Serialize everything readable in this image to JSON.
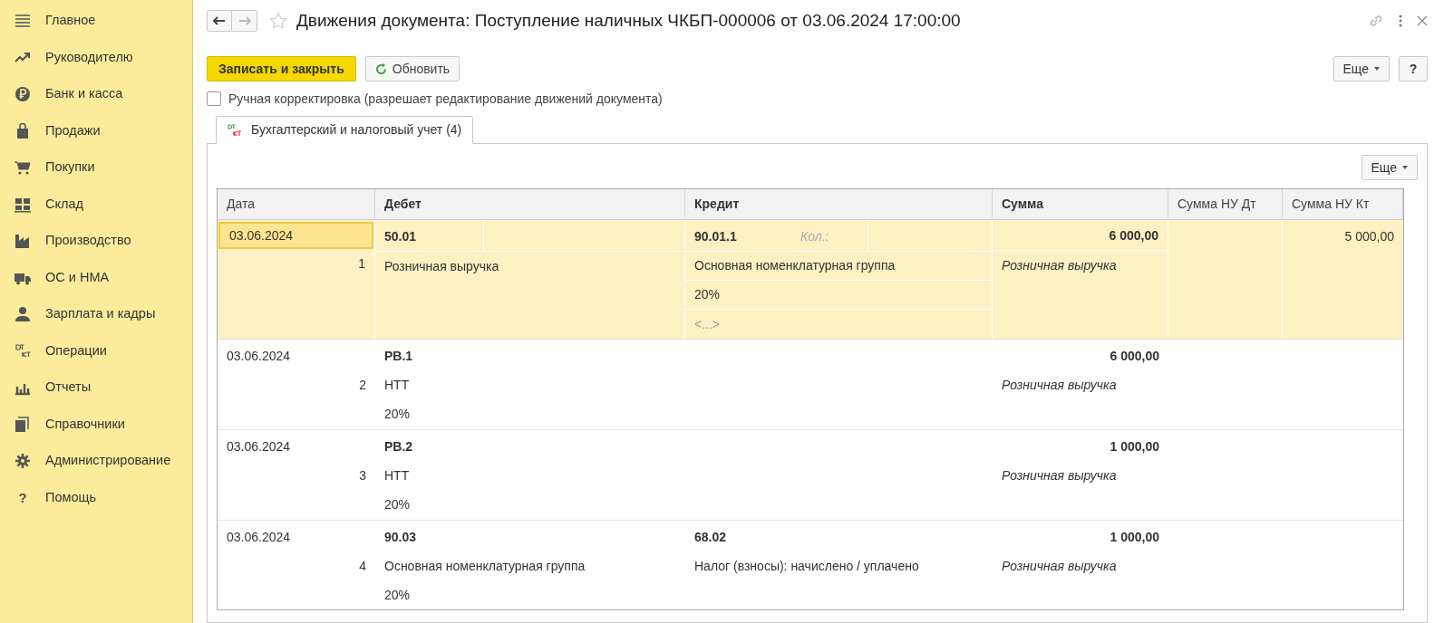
{
  "sidebar": {
    "items": [
      {
        "label": "Главное"
      },
      {
        "label": "Руководителю"
      },
      {
        "label": "Банк и касса"
      },
      {
        "label": "Продажи"
      },
      {
        "label": "Покупки"
      },
      {
        "label": "Склад"
      },
      {
        "label": "Производство"
      },
      {
        "label": "ОС и НМА"
      },
      {
        "label": "Зарплата и кадры"
      },
      {
        "label": "Операции"
      },
      {
        "label": "Отчеты"
      },
      {
        "label": "Справочники"
      },
      {
        "label": "Администрирование"
      },
      {
        "label": "Помощь",
        "glyph": "?"
      }
    ]
  },
  "window": {
    "title": "Движения документа: Поступление наличных ЧКБП-000006 от 03.06.2024 17:00:00",
    "favorite": false
  },
  "toolbar": {
    "save_button": "Записать и закрыть",
    "refresh_button": "Обновить",
    "more_button": "Еще",
    "help_button": "?"
  },
  "manual_edit": {
    "label": "Ручная корректировка (разрешает редактирование движений документа)",
    "checked": false
  },
  "tabs": [
    {
      "label": "Бухгалтерский и налоговый учет (4)",
      "selected": true
    }
  ],
  "table": {
    "more_button": "Еще",
    "columns": [
      "Дата",
      "Дебет",
      "Кредит",
      "Сумма",
      "Сумма НУ Дт",
      "Сумма НУ Кт"
    ],
    "rows": [
      {
        "selected": true,
        "date": "03.06.2024",
        "number": "1",
        "debit_account": "50.01",
        "debit_lines": [
          "Розничная выручка"
        ],
        "credit_account": "90.01.1",
        "credit_quantity": "Кол.:",
        "credit_lines": [
          "Основная номенклатурная группа",
          "20%",
          "<...>"
        ],
        "amount": "6 000,00",
        "amount_note": "Розничная выручка",
        "nu_kt": "5 000,00"
      },
      {
        "selected": false,
        "date": "03.06.2024",
        "number": "2",
        "debit_account": "РВ.1",
        "debit_lines": [
          "НТТ",
          "20%"
        ],
        "amount": "6 000,00",
        "amount_note": "Розничная выручка"
      },
      {
        "selected": false,
        "date": "03.06.2024",
        "number": "3",
        "debit_account": "РВ.2",
        "debit_lines": [
          "НТТ",
          "20%"
        ],
        "amount": "1 000,00",
        "amount_note": "Розничная выручка"
      },
      {
        "selected": false,
        "date": "03.06.2024",
        "number": "4",
        "debit_account": "90.03",
        "debit_lines": [
          "Основная номенклатурная группа",
          "20%"
        ],
        "credit_account": "68.02",
        "credit_lines": [
          "Налог (взносы): начислено / уплачено"
        ],
        "amount": "1 000,00",
        "amount_note": "Розничная выручка"
      }
    ]
  }
}
